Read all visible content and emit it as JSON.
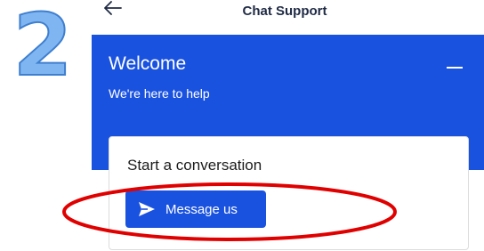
{
  "annotation": {
    "step_number": "2",
    "color": "#5a9fe8",
    "ring_color": "#e00000"
  },
  "header": {
    "title": "Chat Support",
    "back_icon": "arrow-left-icon"
  },
  "banner": {
    "title": "Welcome",
    "subtitle": "We're here to help",
    "minimize_icon": "minus-icon",
    "color": "#1a52e0"
  },
  "card": {
    "title": "Start a conversation",
    "button_label": "Message us",
    "button_icon": "send-icon"
  }
}
